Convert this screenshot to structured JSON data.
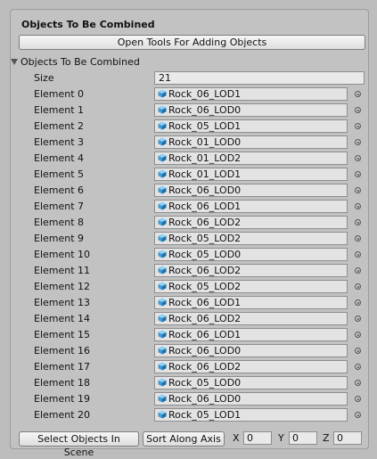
{
  "header": {
    "title": "Objects To Be Combined"
  },
  "open_tools_label": "Open Tools For Adding Objects",
  "foldout": {
    "label": "Objects To Be Combined"
  },
  "size": {
    "label": "Size",
    "value": "21"
  },
  "elements": [
    {
      "label": "Element 0",
      "value": "Rock_06_LOD1"
    },
    {
      "label": "Element 1",
      "value": "Rock_06_LOD0"
    },
    {
      "label": "Element 2",
      "value": "Rock_05_LOD1"
    },
    {
      "label": "Element 3",
      "value": "Rock_01_LOD0"
    },
    {
      "label": "Element 4",
      "value": "Rock_01_LOD2"
    },
    {
      "label": "Element 5",
      "value": "Rock_01_LOD1"
    },
    {
      "label": "Element 6",
      "value": "Rock_06_LOD0"
    },
    {
      "label": "Element 7",
      "value": "Rock_06_LOD1"
    },
    {
      "label": "Element 8",
      "value": "Rock_06_LOD2"
    },
    {
      "label": "Element 9",
      "value": "Rock_05_LOD2"
    },
    {
      "label": "Element 10",
      "value": "Rock_05_LOD0"
    },
    {
      "label": "Element 11",
      "value": "Rock_06_LOD2"
    },
    {
      "label": "Element 12",
      "value": "Rock_05_LOD2"
    },
    {
      "label": "Element 13",
      "value": "Rock_06_LOD1"
    },
    {
      "label": "Element 14",
      "value": "Rock_06_LOD2"
    },
    {
      "label": "Element 15",
      "value": "Rock_06_LOD1"
    },
    {
      "label": "Element 16",
      "value": "Rock_06_LOD0"
    },
    {
      "label": "Element 17",
      "value": "Rock_06_LOD2"
    },
    {
      "label": "Element 18",
      "value": "Rock_05_LOD0"
    },
    {
      "label": "Element 19",
      "value": "Rock_06_LOD0"
    },
    {
      "label": "Element 20",
      "value": "Rock_05_LOD1"
    }
  ],
  "bottom": {
    "select_label": "Select Objects In Scene",
    "sort_label": "Sort Along Axis",
    "x_label": "X",
    "x_value": "0",
    "y_label": "Y",
    "y_value": "0",
    "z_label": "Z",
    "z_value": "0"
  },
  "icons": {
    "object": "mesh-cube-icon",
    "picker": "object-picker-icon",
    "foldout": "foldout-arrow-icon"
  },
  "colors": {
    "cube_light": "#8fd0f5",
    "cube_mid": "#3f9ad6",
    "cube_dark": "#1f6fa8"
  }
}
